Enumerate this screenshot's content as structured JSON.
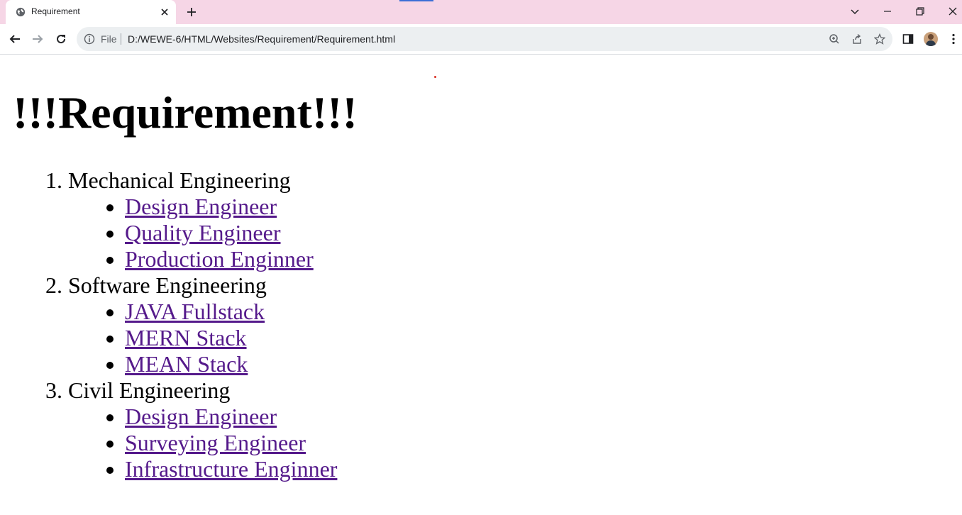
{
  "browser": {
    "tab": {
      "title": "Requirement"
    },
    "address": {
      "scheme": "File",
      "url": "D:/WEWE-6/HTML/Websites/Requirement/Requirement.html"
    }
  },
  "page": {
    "title": "!!!Requirement!!!",
    "sections": [
      {
        "label": "Mechanical Engineering",
        "items": [
          {
            "label": "Design Engineer"
          },
          {
            "label": "Quality Engineer"
          },
          {
            "label": "Production Enginner"
          }
        ]
      },
      {
        "label": "Software Engineering",
        "items": [
          {
            "label": "JAVA Fullstack"
          },
          {
            "label": "MERN Stack"
          },
          {
            "label": "MEAN Stack"
          }
        ]
      },
      {
        "label": "Civil Engineering",
        "items": [
          {
            "label": "Design Engineer"
          },
          {
            "label": "Surveying Engineer"
          },
          {
            "label": "Infrastructure Enginner"
          }
        ]
      }
    ]
  },
  "colors": {
    "tabstrip": "#f6d6e6",
    "link_visited": "#551a8b",
    "omnibox": "#eceff1"
  },
  "icons": [
    "globe-icon",
    "close-icon",
    "plus-icon",
    "chevron-down-icon",
    "minimize-icon",
    "restore-icon",
    "window-close-icon",
    "back-icon",
    "forward-icon",
    "reload-icon",
    "info-icon",
    "zoom-icon",
    "share-icon",
    "star-icon",
    "side-panel-icon",
    "more-icon"
  ]
}
